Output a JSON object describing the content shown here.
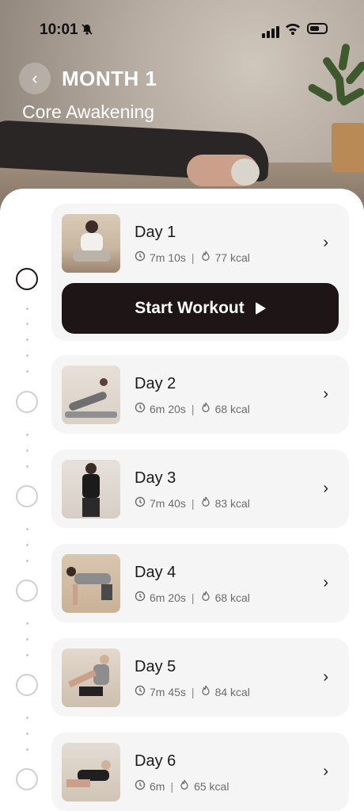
{
  "status": {
    "time": "10:01"
  },
  "header": {
    "title": "MONTH 1",
    "subtitle": "Core Awakening"
  },
  "start_label": "Start Workout",
  "days": [
    {
      "name": "Day 1",
      "duration": "7m 10s",
      "calories": "77 kcal",
      "active": true
    },
    {
      "name": "Day 2",
      "duration": "6m 20s",
      "calories": "68 kcal",
      "active": false
    },
    {
      "name": "Day 3",
      "duration": "7m 40s",
      "calories": "83 kcal",
      "active": false
    },
    {
      "name": "Day 4",
      "duration": "6m 20s",
      "calories": "68 kcal",
      "active": false
    },
    {
      "name": "Day 5",
      "duration": "7m 45s",
      "calories": "84 kcal",
      "active": false
    },
    {
      "name": "Day 6",
      "duration": "6m",
      "calories": "65 kcal",
      "active": false
    }
  ],
  "colors": {
    "accent": "#1d1516",
    "card": "#f5f5f5"
  }
}
